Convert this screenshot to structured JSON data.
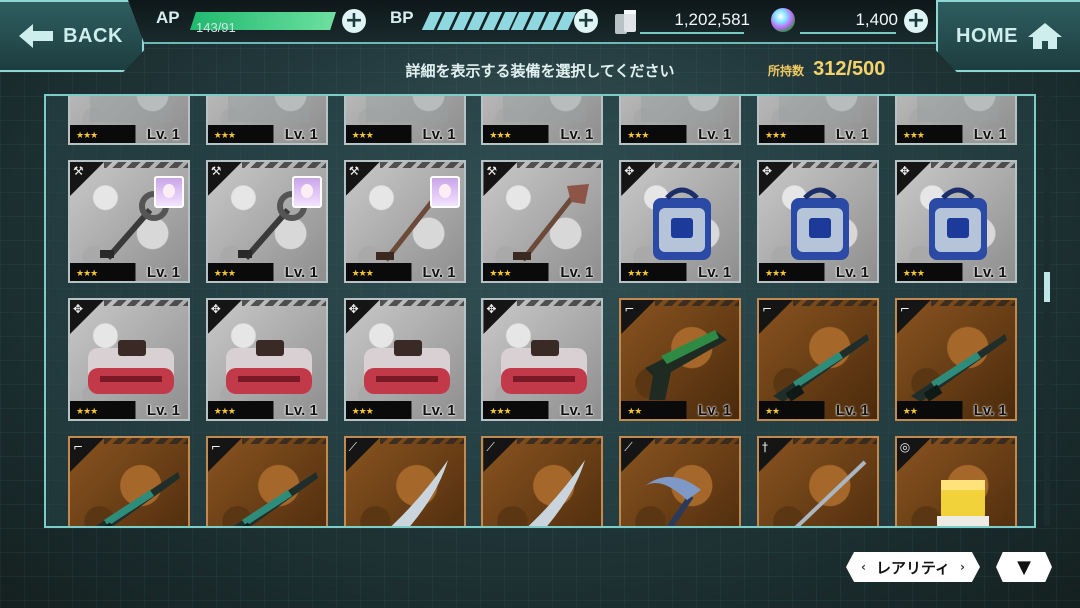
{
  "nav": {
    "back_label": "BACK",
    "home_label": "HOME"
  },
  "stats": {
    "ap_label": "AP",
    "ap_value": "143/91",
    "ap_fill_fraction": 1.0,
    "bp_label": "BP",
    "bp_segments": 10,
    "coins": "1,202,581",
    "gems": "1,400"
  },
  "header": {
    "instruction": "詳細を表示する装備を選択してください",
    "possession_label": "所持数",
    "possession_value": "312/500"
  },
  "colors": {
    "accent": "#7ccdc8",
    "ap_bar": "#21b96e",
    "bp_bar": "#8fd8e0",
    "possession": "#f5d36b",
    "star": "#f4c530"
  },
  "grid": {
    "cards": [
      {
        "frame": "grey",
        "category": "cube-icon",
        "item": "partial",
        "stars": "★★★",
        "level": "Lv. 1"
      },
      {
        "frame": "grey",
        "category": "cube-icon",
        "item": "partial",
        "stars": "★★★",
        "level": "Lv. 1"
      },
      {
        "frame": "grey",
        "category": "cube-icon",
        "item": "partial",
        "stars": "★★★",
        "level": "Lv. 1"
      },
      {
        "frame": "grey",
        "category": "cube-icon",
        "item": "partial",
        "stars": "★★★",
        "level": "Lv. 1"
      },
      {
        "frame": "grey",
        "category": "cube-icon",
        "item": "partial",
        "stars": "★★★",
        "level": "Lv. 1"
      },
      {
        "frame": "grey",
        "category": "cube-icon",
        "item": "partial",
        "stars": "★★★",
        "level": "Lv. 1"
      },
      {
        "frame": "grey",
        "category": "cube-icon",
        "item": "partial",
        "stars": "★★★",
        "level": "Lv. 1"
      },
      {
        "frame": "grey",
        "category": "wrench-icon",
        "item": "wrench",
        "stars": "★★★",
        "level": "Lv. 1",
        "chara": true
      },
      {
        "frame": "grey",
        "category": "wrench-icon",
        "item": "wrench",
        "stars": "★★★",
        "level": "Lv. 1",
        "chara": true
      },
      {
        "frame": "grey",
        "category": "wrench-icon",
        "item": "shovel",
        "stars": "★★★",
        "level": "Lv. 1",
        "chara": true
      },
      {
        "frame": "grey",
        "category": "wrench-icon",
        "item": "shovel",
        "stars": "★★★",
        "level": "Lv. 1"
      },
      {
        "frame": "grey",
        "category": "gear-icon",
        "item": "blue-box",
        "stars": "★★★",
        "level": "Lv. 1"
      },
      {
        "frame": "grey",
        "category": "gear-icon",
        "item": "blue-box",
        "stars": "★★★",
        "level": "Lv. 1"
      },
      {
        "frame": "grey",
        "category": "gear-icon",
        "item": "blue-box",
        "stars": "★★★",
        "level": "Lv. 1"
      },
      {
        "frame": "grey",
        "category": "gear-icon",
        "item": "red-box",
        "stars": "★★★",
        "level": "Lv. 1"
      },
      {
        "frame": "grey",
        "category": "gear-icon",
        "item": "red-box",
        "stars": "★★★",
        "level": "Lv. 1"
      },
      {
        "frame": "grey",
        "category": "gear-icon",
        "item": "red-box",
        "stars": "★★★",
        "level": "Lv. 1"
      },
      {
        "frame": "grey",
        "category": "gear-icon",
        "item": "red-box",
        "stars": "★★★",
        "level": "Lv. 1"
      },
      {
        "frame": "bronze",
        "category": "pistol-icon",
        "item": "pistol",
        "stars": "★★",
        "level": "Lv. 1"
      },
      {
        "frame": "bronze",
        "category": "rifle-icon",
        "item": "rifle",
        "stars": "★★",
        "level": "Lv. 1"
      },
      {
        "frame": "bronze",
        "category": "rifle-icon",
        "item": "rifle",
        "stars": "★★",
        "level": "Lv. 1"
      },
      {
        "frame": "bronze",
        "category": "rifle-icon",
        "item": "rifle",
        "stars": "",
        "level": ""
      },
      {
        "frame": "bronze",
        "category": "rifle-icon",
        "item": "rifle",
        "stars": "",
        "level": ""
      },
      {
        "frame": "bronze",
        "category": "blade-icon",
        "item": "machete",
        "stars": "",
        "level": ""
      },
      {
        "frame": "bronze",
        "category": "blade-icon",
        "item": "machete",
        "stars": "",
        "level": ""
      },
      {
        "frame": "bronze",
        "category": "blade-icon",
        "item": "scythe",
        "stars": "",
        "level": ""
      },
      {
        "frame": "bronze",
        "category": "sword-icon",
        "item": "sword",
        "stars": "",
        "level": ""
      },
      {
        "frame": "bronze",
        "category": "knuckle-icon",
        "item": "glove",
        "stars": "",
        "level": ""
      }
    ]
  },
  "scrollbar": {
    "position_fraction": 0.44
  },
  "footer": {
    "sort_label": "レアリティ",
    "sort_prev": "‹",
    "sort_next": "›",
    "order_glyph": "▼"
  }
}
